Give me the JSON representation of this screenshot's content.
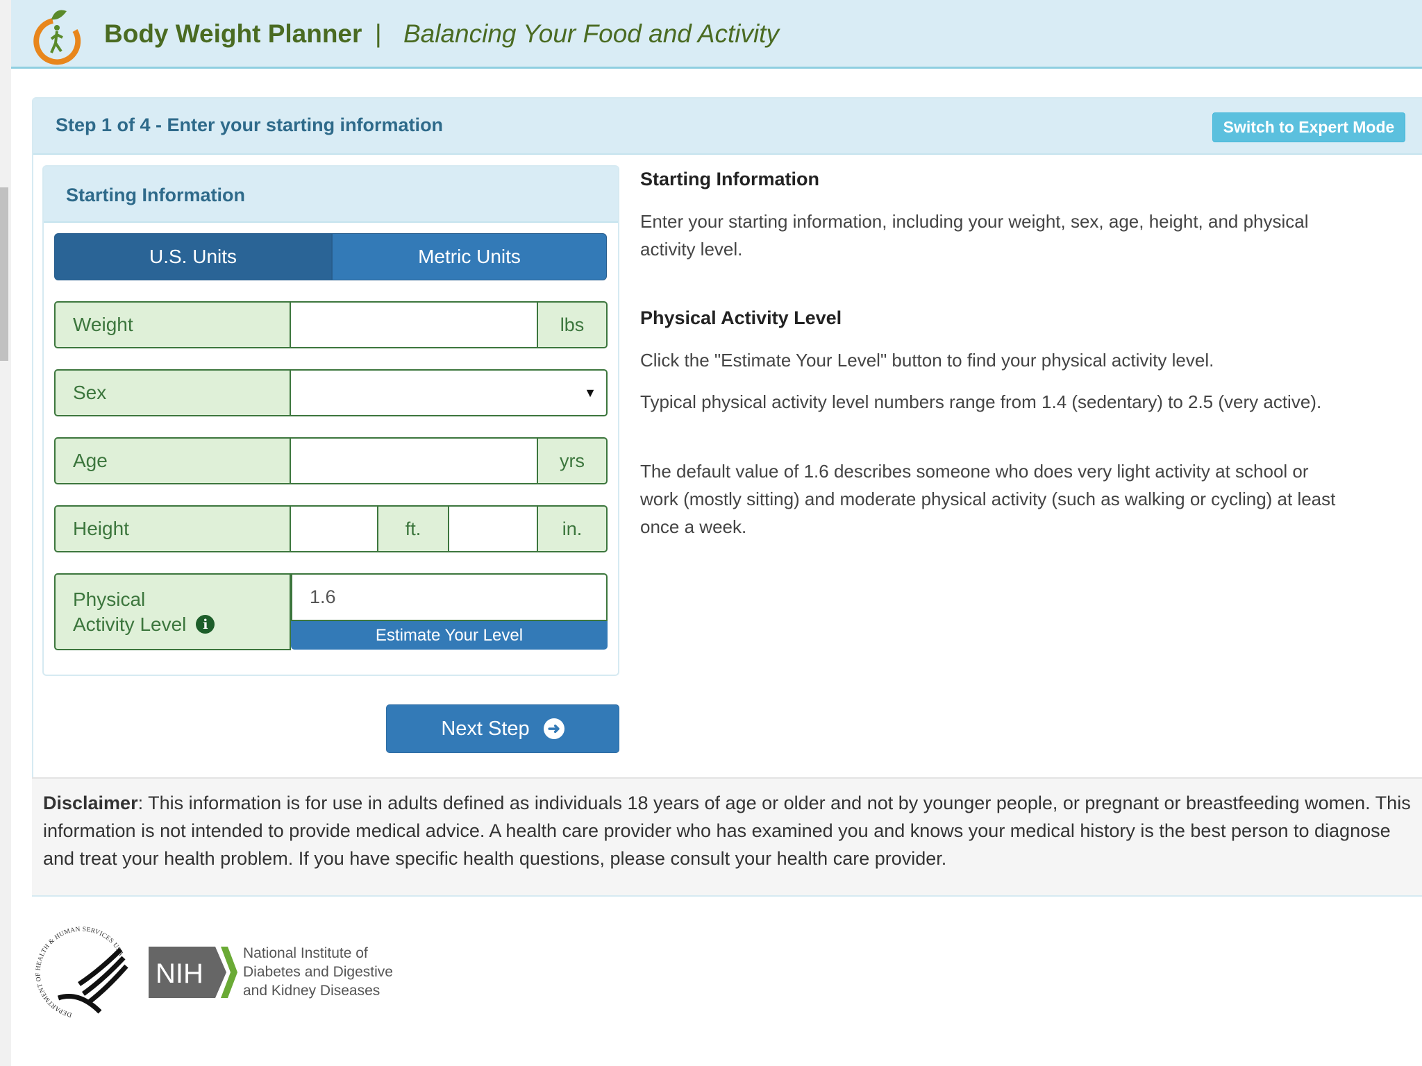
{
  "header": {
    "title": "Body Weight Planner",
    "separator": "|",
    "tagline": "Balancing Your Food and Activity"
  },
  "step": {
    "title": "Step 1 of 4 - Enter your starting information",
    "expert_button": "Switch to Expert Mode"
  },
  "form": {
    "card_title": "Starting Information",
    "units": {
      "us": "U.S. Units",
      "metric": "Metric Units",
      "selected": "us"
    },
    "weight": {
      "label": "Weight",
      "value": "",
      "unit": "lbs"
    },
    "sex": {
      "label": "Sex",
      "value": ""
    },
    "age": {
      "label": "Age",
      "value": "",
      "unit": "yrs"
    },
    "height": {
      "label": "Height",
      "feet": "",
      "feet_unit": "ft.",
      "inches": "",
      "inches_unit": "in."
    },
    "pal": {
      "label_line1": "Physical",
      "label_line2": "Activity Level",
      "value": "1.6",
      "estimate_button": "Estimate Your Level"
    },
    "next_button": "Next Step"
  },
  "help": {
    "heading1": "Starting Information",
    "para1": "Enter your starting information, including your weight, sex, age, height, and physical activity level.",
    "heading2": "Physical Activity Level",
    "para2": "Click the \"Estimate Your Level\" button to find your physical activity level.",
    "para3": "Typical physical activity level numbers range from 1.4 (sedentary) to 2.5 (very active).",
    "para4": "The default value of 1.6 describes someone who does very light activity at school or work (mostly sitting) and moderate physical activity (such as walking or cycling) at least once a week."
  },
  "disclaimer": {
    "label": "Disclaimer",
    "text": ": This information is for use in adults defined as individuals 18 years of age or older and not by younger people, or pregnant or breastfeeding women. This information is not intended to provide medical advice. A health care provider who has examined you and knows your medical history is the best person to diagnose and treat your health problem. If you have specific health questions, please consult your health care provider."
  },
  "footer": {
    "hhs_seal_text": "DEPARTMENT OF HEALTH & HUMAN SERVICES USA",
    "nih_logo": "NIH",
    "niddk_line1": "National Institute of",
    "niddk_line2": "Diabetes and Digestive",
    "niddk_line3": "and Kidney Diseases"
  },
  "colors": {
    "header_bg": "#d9ecf5",
    "brand_green": "#4a6b22",
    "primary": "#337ab7",
    "field_green": "#dff0d8",
    "info": "#5bc0de"
  }
}
